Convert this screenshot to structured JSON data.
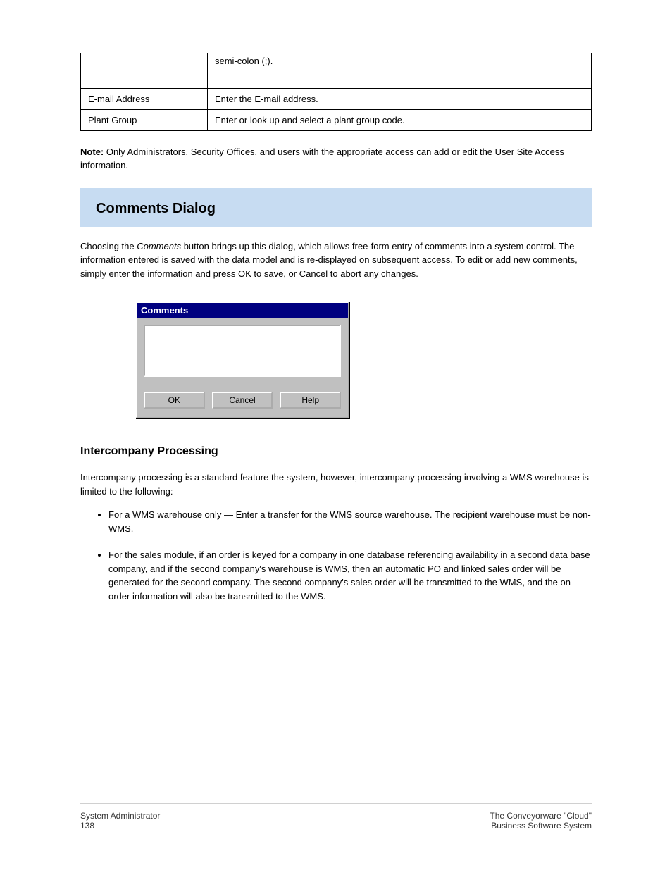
{
  "table": {
    "rows": [
      {
        "col1": "",
        "col2": "semi-colon (;)."
      },
      {
        "col1": "E-mail Address",
        "col2": "Enter the E-mail address."
      },
      {
        "col1": "Plant Group",
        "col2": "Enter or look up and select a plant group code."
      }
    ]
  },
  "note_prefix": "Note:",
  "note_body": "Only Administrators, Security Offices, and users with the appropriate access can add or edit the User Site Access information.",
  "banner": {
    "title": "Comments Dialog"
  },
  "para1_prefix": "Choosing the ",
  "para1_italic": "Comments",
  "para1_suffix": " button brings up this dialog, which allows free-form entry of comments into a system control. The information entered is saved with the data model and is re-displayed on subsequent access. To edit or add new comments, simply enter the information and press OK to save, or Cancel to abort any changes.",
  "dialog": {
    "title": "Comments",
    "textarea_value": "",
    "buttons": {
      "ok": "OK",
      "cancel": "Cancel",
      "help": "Help"
    }
  },
  "intercompany": {
    "heading": "Intercompany Processing",
    "intro": "Intercompany processing is a standard feature the system, however, intercompany processing involving a WMS warehouse is limited to the following:",
    "items": [
      "For a WMS warehouse only — Enter a transfer for the WMS source warehouse. The recipient warehouse must be non-WMS.",
      "For the sales module, if an order is keyed for a company in one database referencing availability in a second data base company, and if the second company's warehouse is WMS, then an automatic PO and linked sales order will be generated for the second company. The second company's sales order will be transmitted to the WMS, and the on order information will also be transmitted to the WMS."
    ]
  },
  "footer": {
    "left_line1": "System Administrator",
    "left_line2": "138",
    "right_line1": "The Conveyorware \"Cloud\"",
    "right_line2": "Business Software System"
  }
}
